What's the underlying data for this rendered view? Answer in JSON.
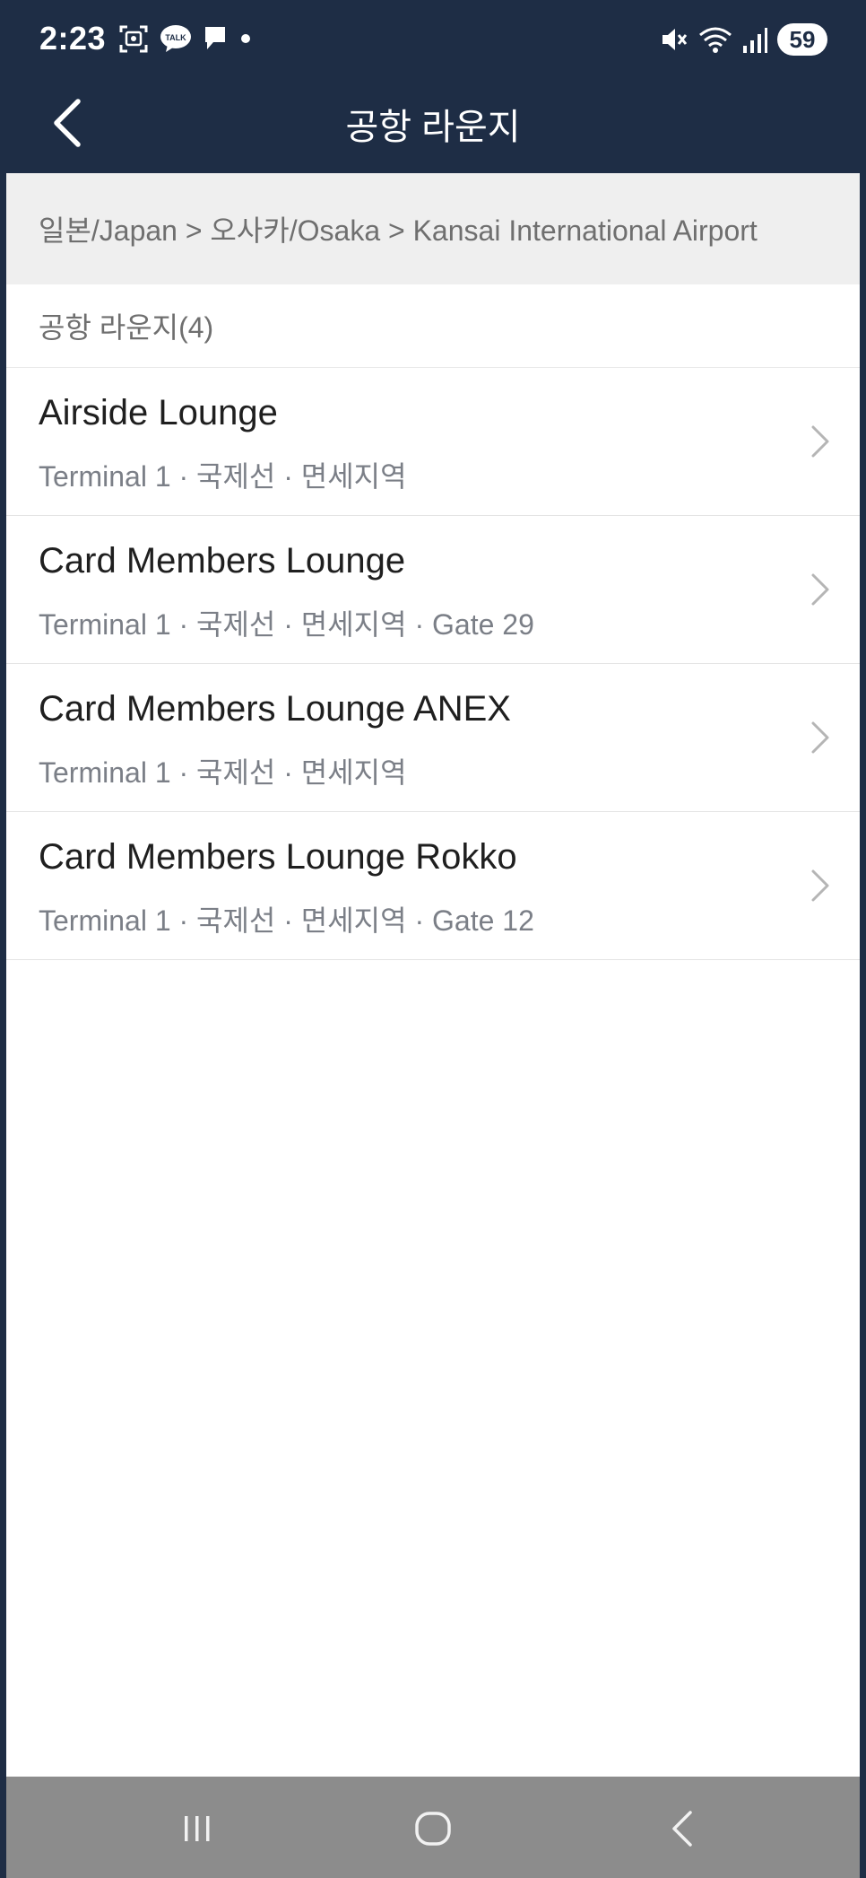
{
  "status_bar": {
    "time": "2:23",
    "battery": "59",
    "talk_badge": "TALK"
  },
  "app_bar": {
    "title": "공항 라운지"
  },
  "breadcrumb": {
    "text": "일본/Japan > 오사카/Osaka > Kansai International Airport"
  },
  "section": {
    "header": "공항 라운지(4)"
  },
  "lounges": [
    {
      "name": "Airside Lounge",
      "detail": "Terminal 1 · 국제선 · 면세지역"
    },
    {
      "name": "Card Members Lounge",
      "detail": "Terminal 1 · 국제선 · 면세지역 · Gate 29"
    },
    {
      "name": "Card Members Lounge ANEX",
      "detail": "Terminal 1 · 국제선 · 면세지역"
    },
    {
      "name": "Card Members Lounge Rokko",
      "detail": "Terminal 1 · 국제선 · 면세지역 · Gate 12"
    }
  ],
  "colors": {
    "header_bg": "#1e2d45",
    "breadcrumb_bg": "#efefef",
    "nav_bar_bg": "#8c8c8c"
  },
  "icons": {
    "back": "arrow-left-icon",
    "chevron": "chevron-right-icon",
    "nav_recents": "recents-icon",
    "nav_home": "home-icon",
    "nav_back": "nav-back-icon"
  }
}
